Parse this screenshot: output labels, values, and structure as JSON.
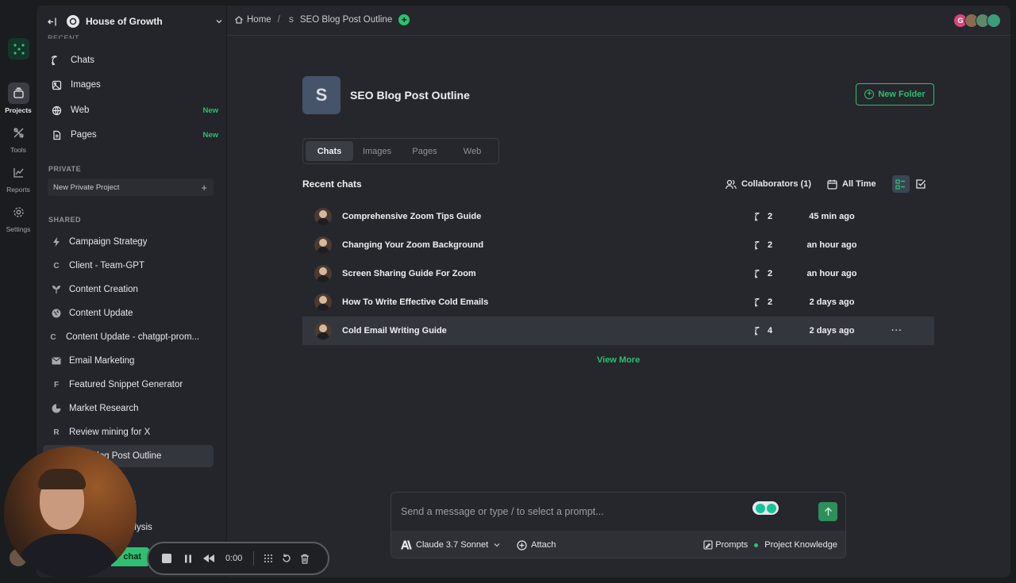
{
  "rail": {
    "items": [
      {
        "label": "Projects",
        "icon": "layers-icon"
      },
      {
        "label": "Tools",
        "icon": "tools-icon"
      },
      {
        "label": "Reports",
        "icon": "chart-icon"
      },
      {
        "label": "Settings",
        "icon": "gear-icon"
      }
    ]
  },
  "sidebar": {
    "workspace": "House of Growth",
    "recent_label": "RECENT",
    "nav": [
      {
        "label": "Chats",
        "badge": ""
      },
      {
        "label": "Images",
        "badge": ""
      },
      {
        "label": "Web",
        "badge": "New"
      },
      {
        "label": "Pages",
        "badge": "New"
      }
    ],
    "private_label": "PRIVATE",
    "new_private": "New Private Project",
    "shared_label": "SHARED",
    "projects": [
      {
        "label": "Campaign Strategy",
        "icon": "⚡"
      },
      {
        "label": "Client - Team-GPT",
        "icon": "C"
      },
      {
        "label": "Content Creation",
        "icon": "🌱"
      },
      {
        "label": "Content Update",
        "icon": "🌐"
      },
      {
        "label": "Content Update - chatgpt-prom...",
        "icon": "C"
      },
      {
        "label": "Email Marketing",
        "icon": "✉"
      },
      {
        "label": "Featured Snippet Generator",
        "icon": "F"
      },
      {
        "label": "Market Research",
        "icon": "◔"
      },
      {
        "label": "Review mining for X",
        "icon": "R"
      },
      {
        "label": "SEO Blog Post Outline",
        "icon": "S"
      }
    ],
    "clipped_1": "s",
    "clipped_2": "alysis",
    "new_chat": "chat"
  },
  "topbar": {
    "home": "Home",
    "separator": "/",
    "project_initial": "S",
    "project": "SEO Blog Post Outline",
    "avatar_g": "G"
  },
  "project": {
    "initial": "S",
    "title": "SEO Blog Post Outline",
    "new_folder": "New Folder",
    "tabs": [
      "Chats",
      "Images",
      "Pages",
      "Web"
    ],
    "recent_title": "Recent chats",
    "collaborators": "Collaborators (1)",
    "time_filter": "All Time",
    "view_more": "View More"
  },
  "chats": [
    {
      "title": "Comprehensive Zoom Tips Guide",
      "count": "2",
      "time": "45 min ago"
    },
    {
      "title": "Changing Your Zoom Background",
      "count": "2",
      "time": "an hour ago"
    },
    {
      "title": "Screen Sharing Guide For Zoom",
      "count": "2",
      "time": "an hour ago"
    },
    {
      "title": "How To Write Effective Cold Emails",
      "count": "2",
      "time": "2 days ago"
    },
    {
      "title": "Cold Email Writing Guide",
      "count": "4",
      "time": "2 days ago"
    }
  ],
  "composer": {
    "placeholder": "Send a message or type / to select a prompt...",
    "model": "Claude 3.7 Sonnet",
    "attach": "Attach",
    "prompts": "Prompts",
    "knowledge": "Project Knowledge"
  },
  "recorder": {
    "time": "0:00"
  },
  "colors": {
    "accent": "#2fbf71",
    "background": "#1b1c1f",
    "panel": "#25272c"
  }
}
